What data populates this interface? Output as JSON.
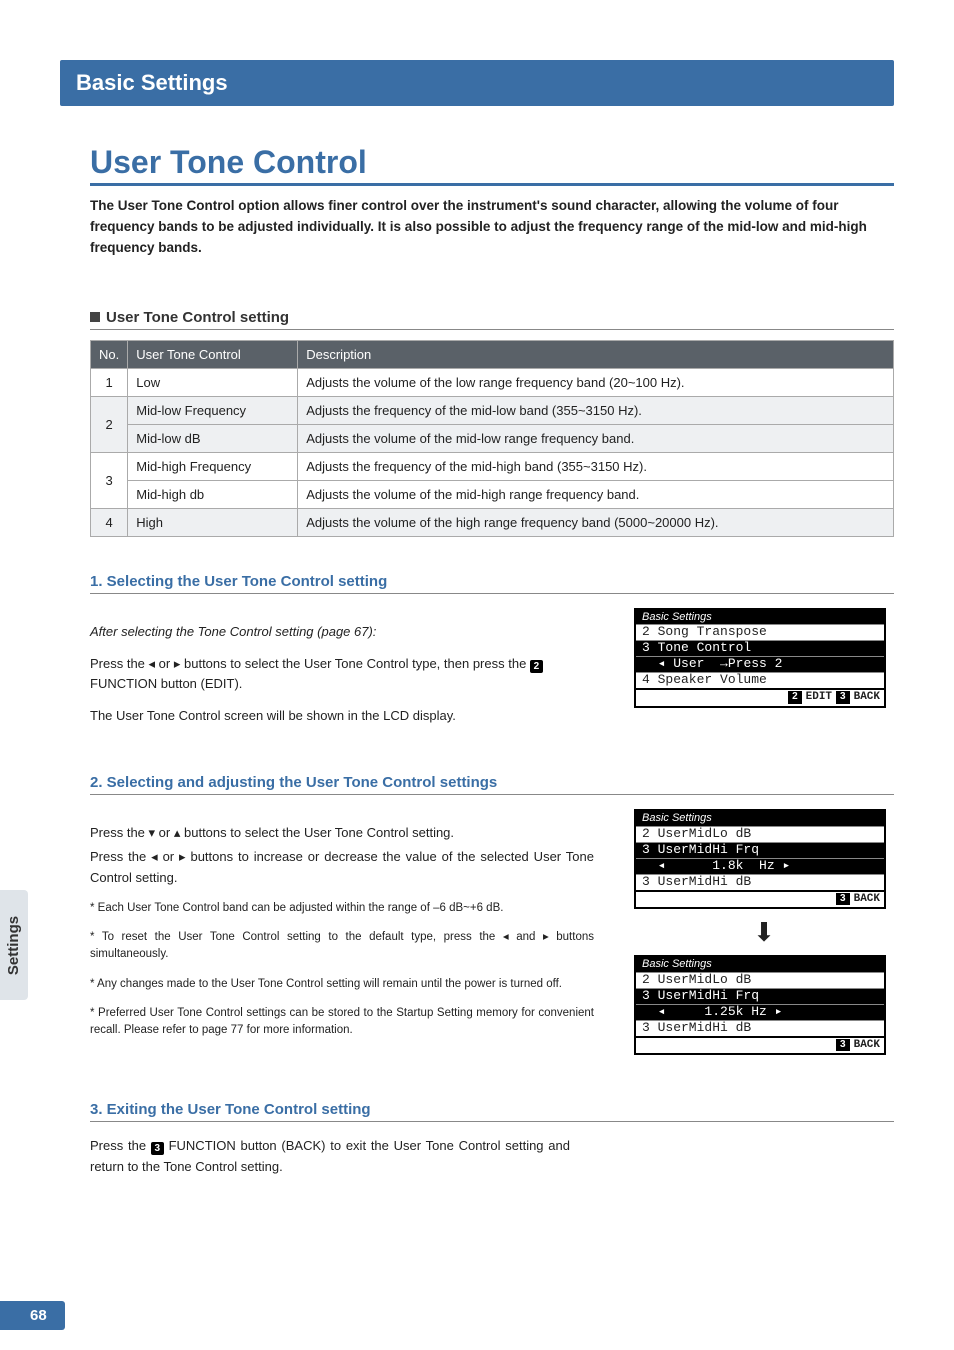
{
  "header": {
    "section": "Basic Settings"
  },
  "title": "User Tone Control",
  "intro": "The User Tone Control option allows finer control over the instrument's sound character, allowing the volume of four frequency bands to be adjusted individually.  It is also possible to adjust the frequency range of the mid-low and mid-high frequency bands.",
  "tableSection": {
    "heading": "User Tone Control setting",
    "cols": {
      "no": "No.",
      "utc": "User Tone Control",
      "desc": "Description"
    },
    "rows": [
      {
        "no": "1",
        "utc": "Low",
        "desc": "Adjusts the volume of the low range frequency band (20~100 Hz)."
      },
      {
        "no": "2",
        "utc": "Mid-low Frequency",
        "desc": "Adjusts the frequency of the mid-low band (355~3150 Hz)."
      },
      {
        "no": "",
        "utc": "Mid-low dB",
        "desc": "Adjusts the volume of the mid-low range frequency band."
      },
      {
        "no": "3",
        "utc": "Mid-high Frequency",
        "desc": "Adjusts the frequency of the mid-high band (355~3150 Hz)."
      },
      {
        "no": "",
        "utc": "Mid-high db",
        "desc": "Adjusts the volume of the mid-high range frequency band."
      },
      {
        "no": "4",
        "utc": "High",
        "desc": "Adjusts the volume of the high range frequency band (5000~20000 Hz)."
      }
    ]
  },
  "step1": {
    "heading": "1. Selecting the User Tone Control setting",
    "preface": "After selecting the Tone Control setting (page 67):",
    "p1a": "Press the ",
    "p1b": " or ",
    "p1c": " buttons to select the User Tone Control type, then press the ",
    "p1d": " FUNCTION button (EDIT).",
    "num2": "2",
    "p2": "The User Tone Control screen will be shown in the LCD display.",
    "lcd": {
      "title": "Basic Settings",
      "l1": "2 Song Transpose",
      "l2": "3 Tone Control",
      "l2b": "  ◂ User  →Press 2",
      "l3": "4 Speaker Volume",
      "btnEditNum": "2",
      "btnEdit": "EDIT",
      "btnBackNum": "3",
      "btnBack": "BACK"
    }
  },
  "step2": {
    "heading": "2. Selecting and adjusting the User Tone Control settings",
    "p1a": "Press the ",
    "p1b": " or ",
    "p1c": " buttons to select the User Tone Control setting.",
    "p2a": "Press the ",
    "p2b": " or ",
    "p2c": " buttons to increase or decrease the value of the selected User Tone Control setting.",
    "notes": [
      "Each User Tone Control band can be adjusted within the range of –6 dB~+6 dB.",
      "To reset the User Tone Control setting to the default type, press the ◂ and ▸ buttons simultaneously.",
      "Any changes made to the User Tone Control setting will remain until the power is turned off.",
      "Preferred User Tone Control settings can be stored to the Startup Setting memory for convenient recall.  Please refer to page 77 for more information."
    ],
    "lcdA": {
      "title": "Basic Settings",
      "l1": "2 UserMidLo dB",
      "l2": "3 UserMidHi Frq",
      "l2b": "  ◂      1.8k  Hz ▸",
      "l3": "3 UserMidHi dB",
      "btnBackNum": "3",
      "btnBack": "BACK"
    },
    "lcdB": {
      "title": "Basic Settings",
      "l1": "2 UserMidLo dB",
      "l2": "3 UserMidHi Frq",
      "l2b": "  ◂     1.25k Hz ▸",
      "l3": "3 UserMidHi dB",
      "btnBackNum": "3",
      "btnBack": "BACK"
    }
  },
  "step3": {
    "heading": "3. Exiting the User Tone Control setting",
    "p1a": "Press the ",
    "num3": "3",
    "p1b": " FUNCTION button (BACK) to exit the User Tone Control setting and return to the Tone Control setting."
  },
  "sideTab": "Settings",
  "pageNumber": "68",
  "glyphs": {
    "left": "◂",
    "right": "▸",
    "up": "▴",
    "down": "▾",
    "bigdown": "⬇"
  }
}
